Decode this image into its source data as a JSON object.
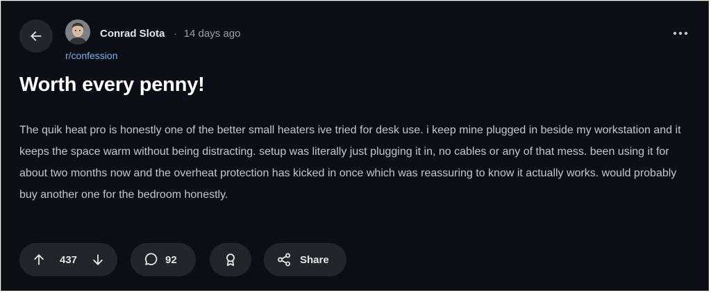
{
  "post": {
    "author": "Conrad Slota",
    "separator": "·",
    "time_ago": "14 days ago",
    "subreddit": "r/confession",
    "title": "Worth every penny!",
    "body": "The quik heat pro is honestly one of the better small heaters ive tried for desk use. i keep mine plugged in beside my workstation and it keeps the space warm without being distracting. setup was literally just plugging it in, no cables or any of that mess. been using it for about two months now and the overheat protection has kicked in once which was reassuring to know it actually works. would probably buy another one for the bedroom honestly."
  },
  "actions": {
    "vote_count": "437",
    "comment_count": "92",
    "share_label": "Share"
  },
  "icons": {
    "back": "arrow-left-icon",
    "overflow": "more-horizontal-icon",
    "upvote": "arrow-up-icon",
    "downvote": "arrow-down-icon",
    "comment": "speech-bubble-icon",
    "award": "award-ribbon-icon",
    "share": "share-nodes-icon"
  },
  "colors": {
    "background": "#0b0e14",
    "pill_background": "#22262c",
    "subreddit_link": "#7fb3f0",
    "body_text": "#c3c8cf",
    "title_text": "#ffffff"
  }
}
